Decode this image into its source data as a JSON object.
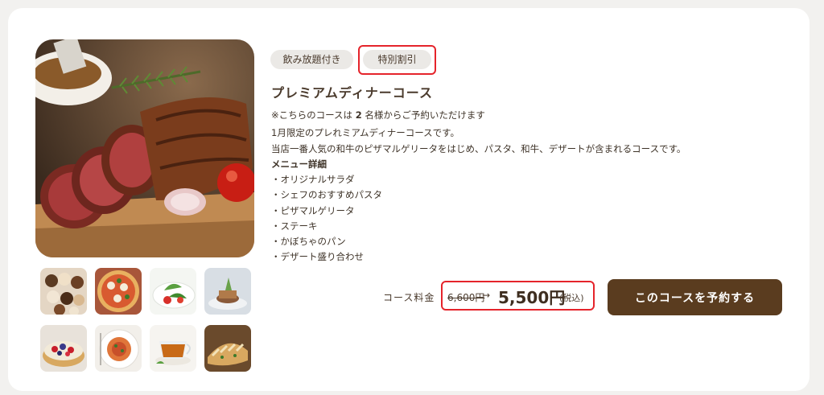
{
  "course": {
    "tags": [
      {
        "label": "飲み放題付き"
      },
      {
        "label": "特別割引"
      }
    ],
    "title": "プレミアムディナーコース",
    "note_prefix": "※こちらのコースは",
    "note_count": "2",
    "note_suffix": "名様からご予約いただけます",
    "desc_line1": "1月限定のプレれミアムディナーコースです。",
    "desc_line2": "当店一番人気の和牛のピザマルゲリータをはじめ、パスタ、和牛、デザートが含まれるコースです。",
    "menu_heading": "メニュー詳細",
    "menu_items": [
      "・オリジナルサラダ",
      "・シェフのおすすめパスタ",
      "・ピザマルゲリータ",
      "・ステーキ",
      "・かぼちゃのパン",
      "・デザート盛り合わせ"
    ],
    "price_label": "コース料金",
    "old_price": "6,600円",
    "arrow": "→",
    "new_price": "5,500円",
    "tax_note": "(税込)",
    "reserve_label": "このコースを予約する"
  },
  "images": {
    "main": "roast-beef-photo",
    "thumbnails": [
      "cupcakes-photo",
      "pizza-photo",
      "salad-photo",
      "appetizer-photo",
      "berry-tart-photo",
      "pasta-photo",
      "tea-photo",
      "bread-photo"
    ]
  },
  "colors": {
    "brand": "#5a3c1f",
    "highlight": "#e5242b",
    "tag_bg": "#ebe9e6",
    "text": "#4a3a2c"
  }
}
